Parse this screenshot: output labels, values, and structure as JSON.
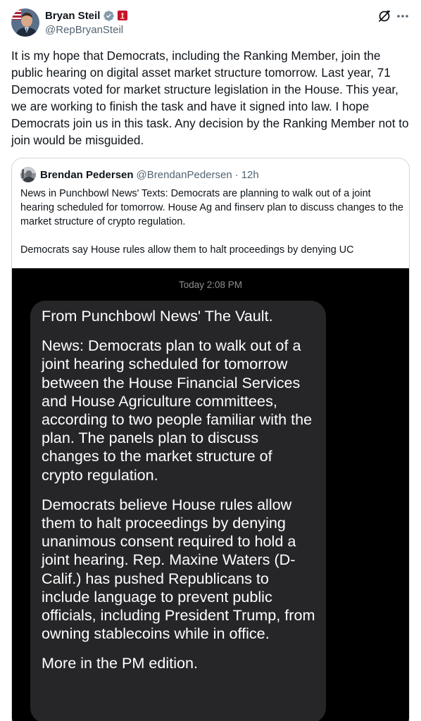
{
  "author": {
    "display_name": "Bryan Steil",
    "handle": "@RepBryanSteil"
  },
  "tweet_text": "It is my hope that Democrats, including the Ranking Member, join the public hearing on digital asset market structure tomorrow. Last year, 71 Democrats voted for market structure legislation in the House. This year, we are working to finish the task and have it signed into law. I hope Democrats join us in this task. Any decision by the Ranking Member not to join would be misguided.",
  "quote": {
    "display_name": "Brendan Pedersen",
    "handle": "@BrendanPedersen",
    "separator": "·",
    "time": "12h",
    "paragraphs": [
      "News in Punchbowl News' Texts: Democrats are planning to walk out of a joint hearing scheduled for tomorrow. House Ag and finserv plan to discuss changes to the market structure of crypto regulation.",
      "Democrats say House rules allow them to halt proceedings by denying UC"
    ]
  },
  "media": {
    "timestamp_day": "Today",
    "timestamp_time": "2:08 PM",
    "message_paragraphs": [
      "From Punchbowl News' The Vault.",
      "News: Democrats plan to walk out of a joint hearing scheduled for tomorrow between the House Financial Services and House Agriculture committees, according to two people familiar with the plan. The panels plan to discuss changes to the market structure of crypto regulation.",
      "Democrats believe House rules allow them to halt proceedings by denying unanimous consent required to hold a joint hearing. Rep. Maxine Waters (D-Calif.) has pushed Republicans to include language to prevent public officials, including President Trump, from owning stablecoins while in office.",
      "More in the PM edition."
    ]
  },
  "icons": {
    "verified": "verified-badge-icon",
    "affiliation": "house-affiliation-icon",
    "grok": "grok-icon",
    "more": "more-options-icon"
  },
  "colors": {
    "verified": "#829aab",
    "affiliation": "#c8102e",
    "secondary_text": "#536471",
    "bubble": "#262629"
  }
}
